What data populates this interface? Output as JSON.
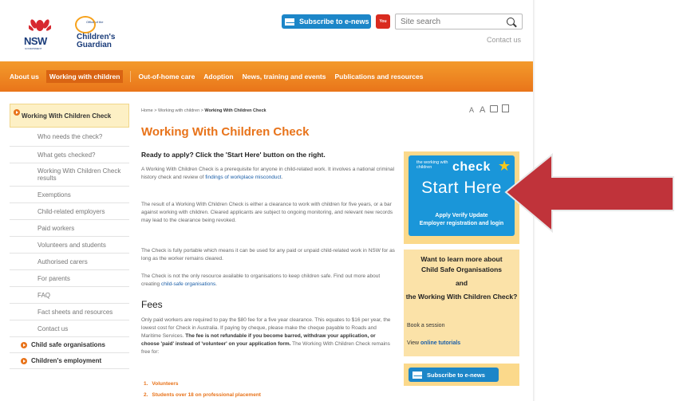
{
  "header": {
    "nsw_logo": "NSW",
    "nsw_gov": "GOVERNMENT",
    "cg_logo_small": "Office of the",
    "cg_logo_line1": "Children's",
    "cg_logo_line2": "Guardian",
    "subscribe_label": "Subscribe to e-news",
    "youtube_label": "You Tube",
    "search_placeholder": "Site search",
    "contact_label": "Contact us"
  },
  "nav": {
    "items": [
      {
        "label": "About us"
      },
      {
        "label": "Working with children",
        "active": true
      },
      {
        "label": "Out-of-home care"
      },
      {
        "label": "Adoption"
      },
      {
        "label": "News, training and events"
      },
      {
        "label": "Publications and resources"
      }
    ]
  },
  "sidebar": {
    "top_item": "Working With Children Check",
    "sub_items": [
      "Who needs the check?",
      "What gets checked?",
      "Working With Children Check results",
      "Exemptions",
      "Child-related employers",
      "Paid workers",
      "Volunteers and students",
      "Authorised carers",
      "For parents",
      "FAQ",
      "Fact sheets and resources",
      "Contact us"
    ],
    "section_items": [
      "Child safe organisations",
      "Children's employment"
    ]
  },
  "breadcrumb": {
    "home": "Home",
    "sep": ">",
    "parent": "Working with children",
    "current": "Working With Children Check"
  },
  "tools": {
    "small_a": "A",
    "big_a": "A"
  },
  "main": {
    "title": "Working With Children Check",
    "lead": "Ready to apply? Click the 'Start Here' button on the right.",
    "p1_text": "A Working With Children Check is a prerequisite for anyone in child-related work. It involves a national criminal history check and review of ",
    "p1_link": "findings of workplace misconduct",
    "p1_end": ".",
    "p2": "The result of a Working With Children Check is either a clearance to work with children for five years, or a bar against working with children. Cleared applicants are subject to ongoing monitoring, and relevant new records may lead to the clearance being revoked.",
    "p3": "The Check is fully portable which means it can be used for any paid or unpaid child-related work in NSW for as long as the worker remains cleared.",
    "p4_text": "The Check is not the only resource available to organisations to keep children safe. Find out more about creating ",
    "p4_link": "child-safe organisations",
    "p4_end": ".",
    "fees_heading": "Fees",
    "fees_text": "Only paid workers are required to pay the $80 fee for a five year clearance. This equates to $16 per year, the lowest cost for Check in Australia. If paying by cheque, please make the cheque payable to Roads and Maritime Services. ",
    "fees_bold": "The fee is not refundable if you become barred, withdraw your application, or choose 'paid' instead of 'volunteer' on your application form.",
    "fees_end": " The Working With Children Check remains free for:",
    "list": [
      "Volunteers",
      "Students over 18 on professional placement"
    ]
  },
  "start_panel": {
    "wwc_small": "the working with children",
    "check": "check",
    "start": "Start Here",
    "links1": "Apply  Verify  Update",
    "links2": "Employer registration and login"
  },
  "cso_panel": {
    "line1": "Want to learn more about",
    "line2": "Child Safe Organisations",
    "line3": "and",
    "line4": "the Working With Children Check?",
    "book": "Book a session",
    "view": "View ",
    "tutorials": "online tutorials"
  },
  "subscribe_bottom": {
    "label": "Subscribe to e-news"
  },
  "colors": {
    "accent": "#e8731a",
    "blue": "#1c86c8",
    "arrow": "#c0333a"
  }
}
